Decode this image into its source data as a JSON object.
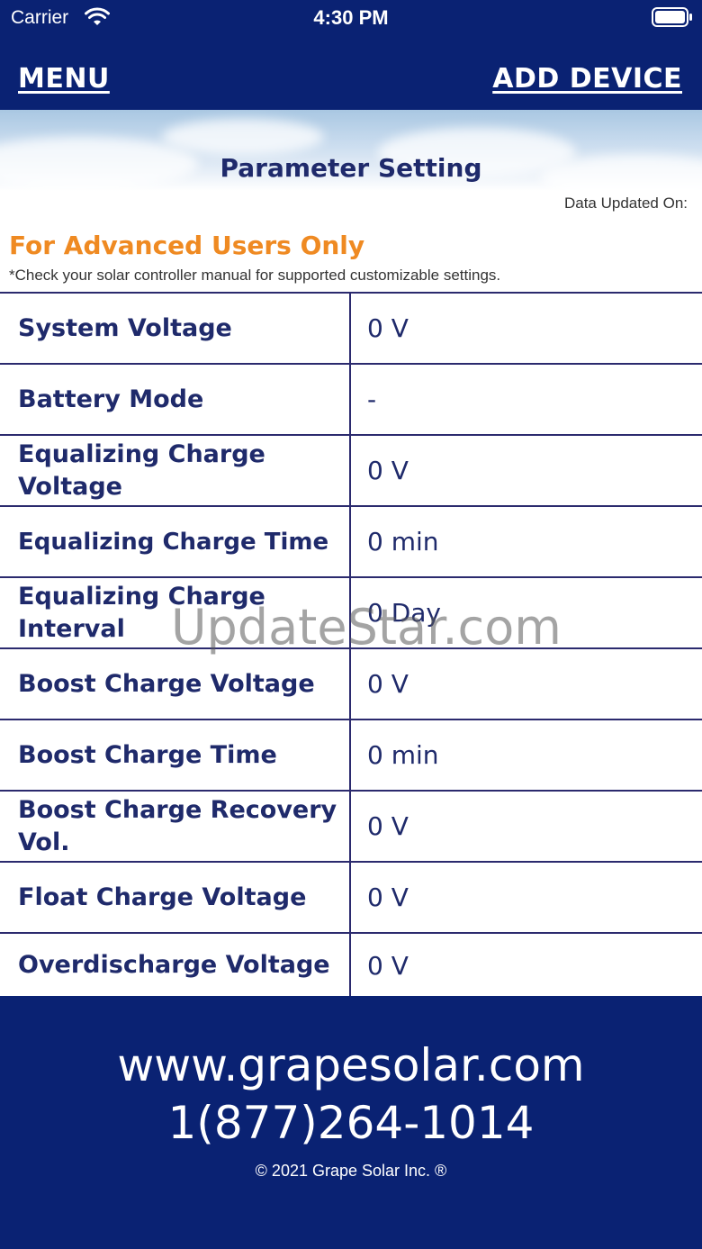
{
  "status_bar": {
    "carrier": "Carrier",
    "time": "4:30 PM",
    "wifi_icon": "wifi-icon",
    "battery_icon": "battery-full-icon"
  },
  "nav": {
    "menu_label": "MENU",
    "add_device_label": "ADD DEVICE"
  },
  "header": {
    "title": "Parameter Setting",
    "data_updated_label": "Data Updated On:"
  },
  "advanced": {
    "title": "For Advanced Users Only",
    "note": "*Check your solar controller manual for supported customizable settings."
  },
  "parameters": [
    {
      "label": "System Voltage",
      "value": "0 V"
    },
    {
      "label": "Battery Mode",
      "value": "-"
    },
    {
      "label": "Equalizing Charge Voltage",
      "value": "0 V"
    },
    {
      "label": "Equalizing Charge Time",
      "value": "0 min"
    },
    {
      "label": "Equalizing Charge Interval",
      "value": "0 Day"
    },
    {
      "label": "Boost Charge Voltage",
      "value": "0 V"
    },
    {
      "label": "Boost Charge Time",
      "value": "0 min"
    },
    {
      "label": "Boost Charge Recovery Vol.",
      "value": "0 V"
    },
    {
      "label": "Float Charge Voltage",
      "value": "0 V"
    },
    {
      "label": "Overdischarge Voltage",
      "value": "0 V"
    }
  ],
  "watermark": "UpdateStar.com",
  "footer": {
    "website": "www.grapesolar.com",
    "phone": "1(877)264-1014",
    "copyright": "© 2021 Grape Solar Inc. ®"
  },
  "colors": {
    "brand_navy": "#0a2273",
    "accent_orange": "#ef8a22",
    "text_navy": "#1f2a6b"
  }
}
